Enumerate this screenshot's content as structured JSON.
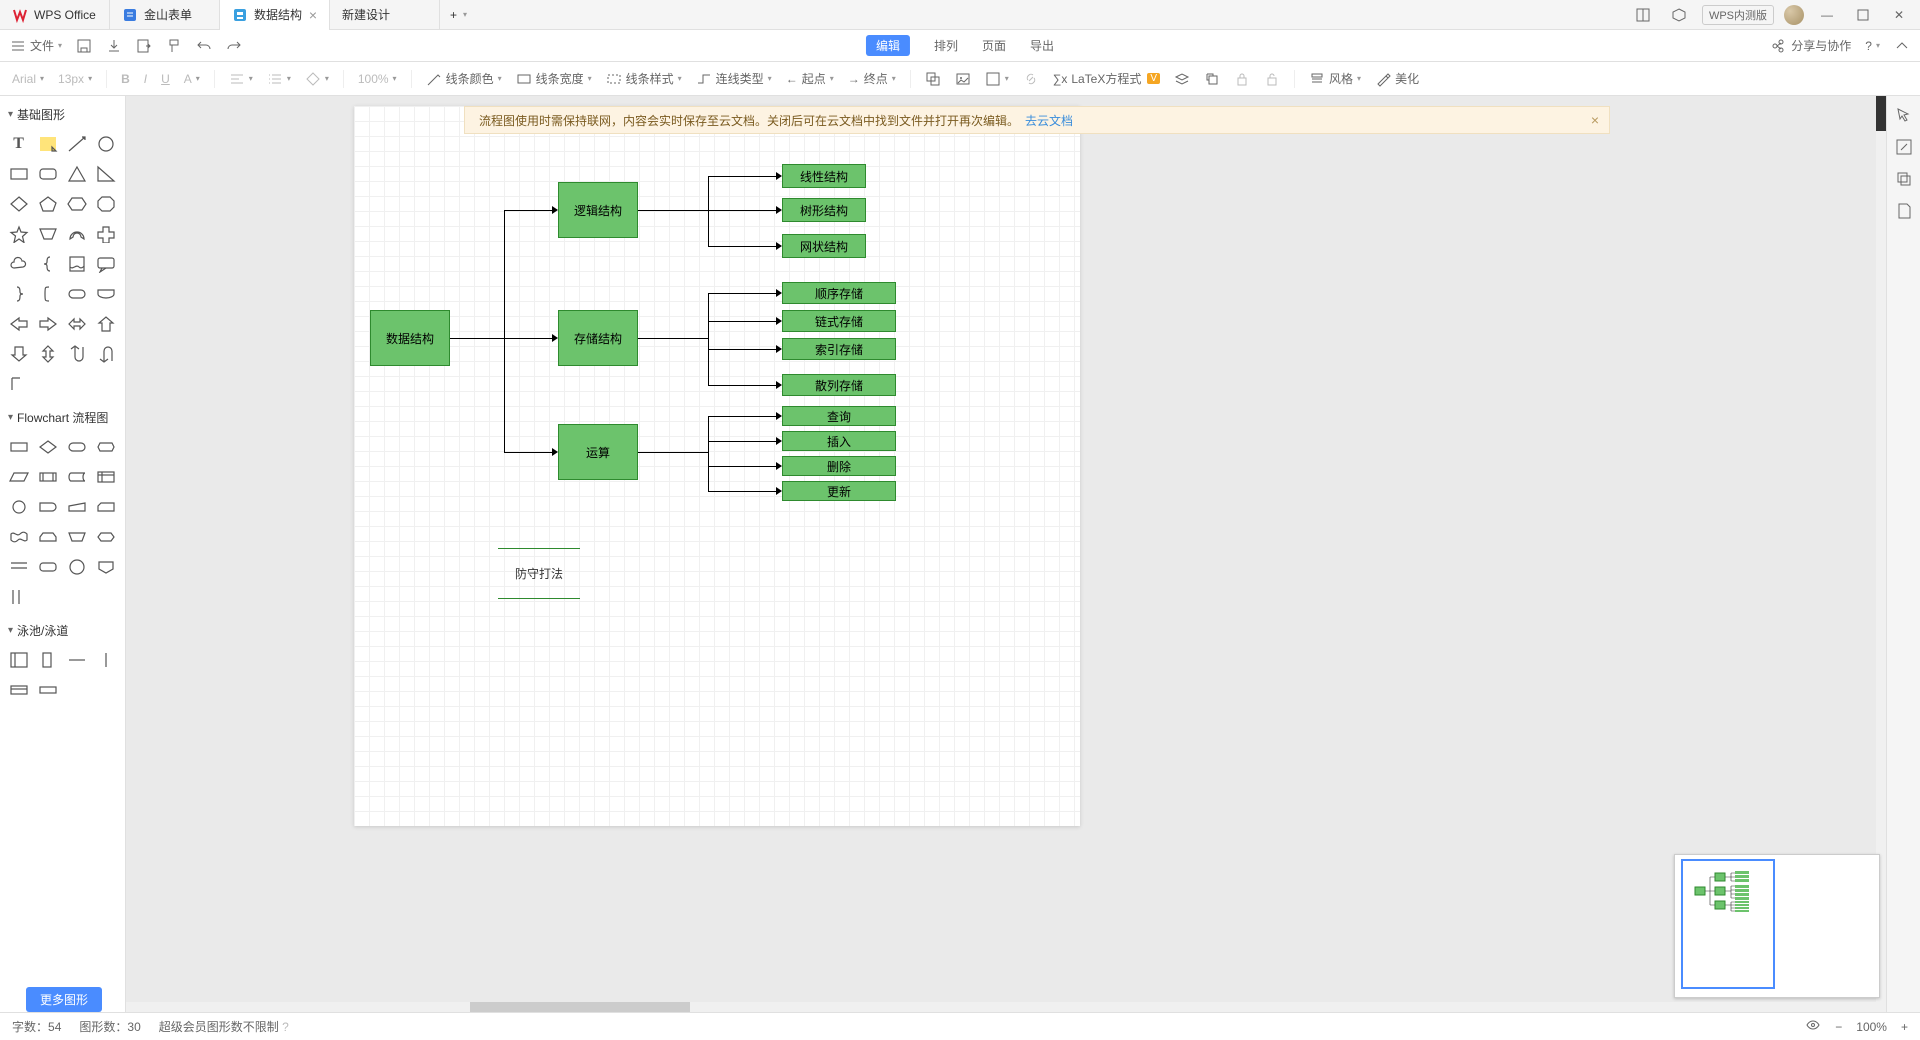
{
  "tabs": {
    "t0": "WPS Office",
    "t1": "金山表单",
    "t2": "数据结构",
    "t3": "新建设计"
  },
  "title_right": {
    "badge": "WPS内测版"
  },
  "toolbar1": {
    "file": "文件",
    "edit": "编辑",
    "arrange": "排列",
    "page": "页面",
    "export": "导出",
    "share": "分享与协作"
  },
  "toolbar2": {
    "font": "Arial",
    "size": "13px",
    "zoom": "100%",
    "line_color": "线条颜色",
    "line_width": "线条宽度",
    "line_style": "线条样式",
    "connector": "连线类型",
    "start": "起点",
    "end": "终点",
    "latex": "LaTeX方程式",
    "style": "风格",
    "beautify": "美化"
  },
  "banner": {
    "text": "流程图使用时需保持联网，内容会实时保存至云文档。关闭后可在云文档中找到文件并打开再次编辑。",
    "link": "去云文档"
  },
  "shapes": {
    "basic": "基础图形",
    "flowchart": "Flowchart 流程图",
    "swimlane": "泳池/泳道",
    "more": "更多图形"
  },
  "diagram": {
    "root": "数据结构",
    "l1a": "逻辑结构",
    "l1b": "存储结构",
    "l1c": "运算",
    "a1": "线性结构",
    "a2": "树形结构",
    "a3": "网状结构",
    "b1": "顺序存储",
    "b2": "链式存储",
    "b3": "索引存储",
    "b4": "散列存储",
    "c1": "查询",
    "c2": "插入",
    "c3": "删除",
    "c4": "更新",
    "note": "防守打法"
  },
  "status": {
    "words_label": "字数：",
    "words": "54",
    "shapes_label": "图形数：",
    "shapes": "30",
    "vip": "超级会员图形数不限制",
    "zoom": "100%"
  }
}
